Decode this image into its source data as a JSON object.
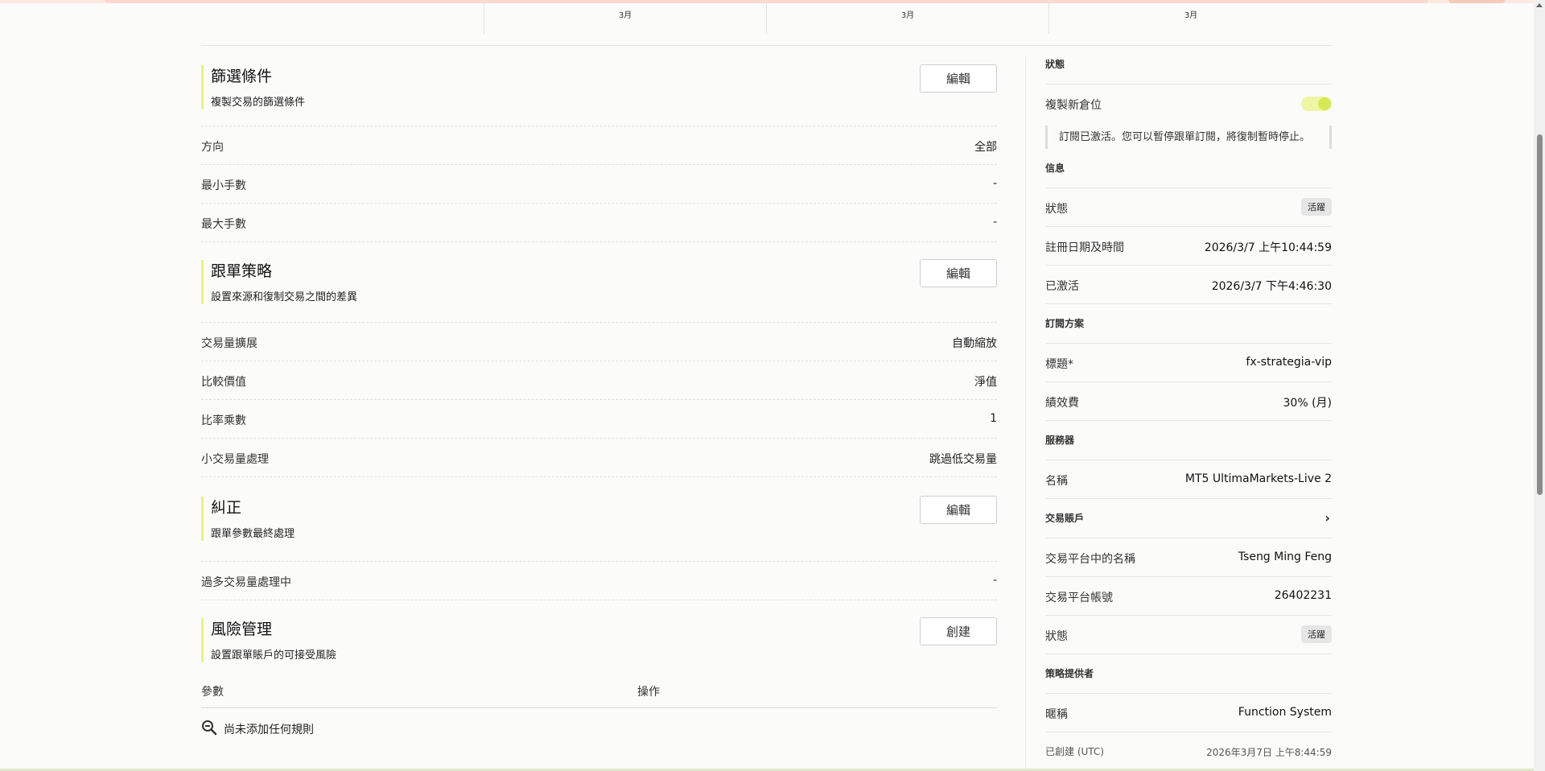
{
  "months": [
    "3月",
    "3月",
    "3月"
  ],
  "filter": {
    "title": "篩選條件",
    "subtitle": "複製交易的篩選條件",
    "button": "編輯",
    "rows": [
      {
        "label": "方向",
        "value": "全部"
      },
      {
        "label": "最小手數",
        "value": "-"
      },
      {
        "label": "最大手數",
        "value": "-"
      }
    ]
  },
  "strategy": {
    "title": "跟單策略",
    "subtitle": "設置來源和復制交易之間的差異",
    "button": "編輯",
    "rows": [
      {
        "label": "交易量擴展",
        "value": "自動縮放"
      },
      {
        "label": "比較價值",
        "value": "淨值"
      },
      {
        "label": "比率乘數",
        "value": "1"
      },
      {
        "label": "小交易量處理",
        "value": "跳過低交易量"
      }
    ]
  },
  "correction": {
    "title": "糾正",
    "subtitle": "跟單參數最終處理",
    "button": "編輯",
    "rows": [
      {
        "label": "過多交易量處理中",
        "value": "-"
      }
    ]
  },
  "risk": {
    "title": "風險管理",
    "subtitle": "設置跟單賬戶的可接受風險",
    "button": "創建",
    "col_param": "參數",
    "col_action": "操作",
    "empty": "尚未添加任何規則"
  },
  "side": {
    "status_section": "狀態",
    "copy_new_label": "複製新倉位",
    "copy_new_on": true,
    "note": "訂閱已激活。您可以暫停跟單訂閱，將復制暫時停止。",
    "info_section": "信息",
    "info": {
      "status_label": "狀態",
      "status_value": "活躍",
      "reg_label": "註冊日期及時間",
      "reg_value": "2026/3/7 上午10:44:59",
      "act_label": "已激活",
      "act_value": "2026/3/7 下午4:46:30"
    },
    "plan_section": "訂閱方案",
    "plan": {
      "title_label": "標題*",
      "title_value": "fx-strategia-vip",
      "fee_label": "績效費",
      "fee_value": "30% (月)"
    },
    "server_section": "服務器",
    "server": {
      "name_label": "名稱",
      "name_value": "MT5 UltimaMarkets-Live 2"
    },
    "account_section": "交易賬戶",
    "account": {
      "name_label": "交易平台中的名稱",
      "name_value": "Tseng Ming Feng",
      "acct_label": "交易平台帳號",
      "acct_value": "26402231",
      "status_label": "狀態",
      "status_value": "活躍"
    },
    "provider_section": "策略提供者",
    "provider": {
      "nick_label": "暱稱",
      "nick_value": "Function System",
      "created_label": "已創建 (UTC)",
      "created_value": "2026年3月7日 上午8:44:59"
    }
  },
  "colors": {
    "accent": "#e8ef8c",
    "toggle": "#d5e855"
  }
}
